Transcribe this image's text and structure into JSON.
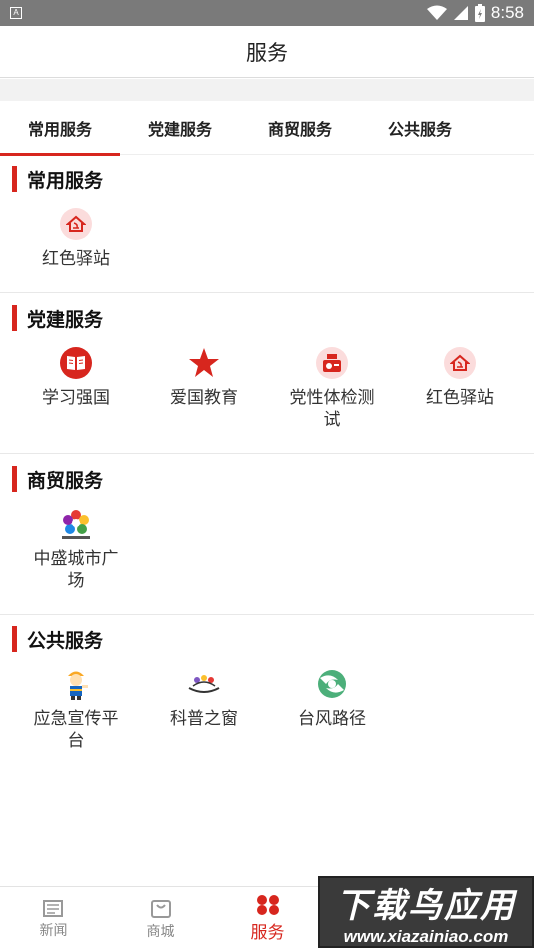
{
  "status_bar": {
    "time": "8:58",
    "app_icon": "A"
  },
  "header": {
    "title": "服务"
  },
  "tabs": [
    {
      "label": "常用服务",
      "active": true
    },
    {
      "label": "党建服务",
      "active": false
    },
    {
      "label": "商贸服务",
      "active": false
    },
    {
      "label": "公共服务",
      "active": false
    }
  ],
  "sections": {
    "common": {
      "title": "常用服务",
      "items": [
        {
          "label": "红色驿站",
          "icon": "red-station-icon"
        }
      ]
    },
    "party": {
      "title": "党建服务",
      "items": [
        {
          "label": "学习强国",
          "icon": "study-book-icon"
        },
        {
          "label": "爱国教育",
          "icon": "red-star-icon"
        },
        {
          "label": "党性体检测试",
          "icon": "test-icon"
        },
        {
          "label": "红色驿站",
          "icon": "red-station-icon"
        }
      ]
    },
    "commerce": {
      "title": "商贸服务",
      "items": [
        {
          "label": "中盛城市广场",
          "icon": "plaza-logo-icon"
        }
      ]
    },
    "public": {
      "title": "公共服务",
      "items": [
        {
          "label": "应急宣传平台",
          "icon": "worker-icon"
        },
        {
          "label": "科普之窗",
          "icon": "science-icon"
        },
        {
          "label": "台风路径",
          "icon": "typhoon-icon"
        }
      ]
    }
  },
  "bottom_nav": [
    {
      "label": "新闻",
      "icon": "news-icon",
      "active": false
    },
    {
      "label": "商城",
      "icon": "shop-bag-icon",
      "active": false
    },
    {
      "label": "服务",
      "icon": "service-icon",
      "active": true
    }
  ],
  "watermark": {
    "title": "下载鸟应用",
    "url": "www.xiazainiao.com"
  },
  "colors": {
    "accent": "#d7261e",
    "divider": "#e8e8e8"
  }
}
